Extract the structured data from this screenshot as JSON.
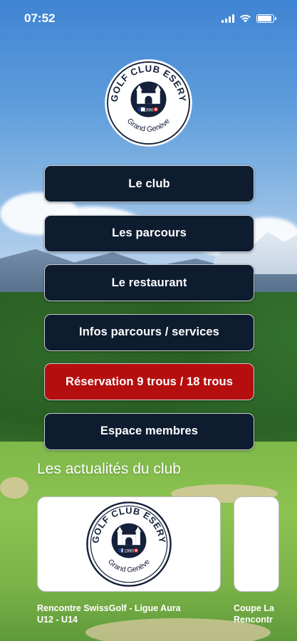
{
  "status_bar": {
    "time": "07:52"
  },
  "logo": {
    "text_top": "GOLF CLUB ESERY",
    "text_bottom": "Grand Genève",
    "year": "1990"
  },
  "menu": {
    "items": [
      {
        "label": "Le club"
      },
      {
        "label": "Les parcours"
      },
      {
        "label": "Le restaurant"
      },
      {
        "label": "Infos parcours / services"
      },
      {
        "label": "Réservation 9 trous / 18 trous"
      },
      {
        "label": "Espace membres"
      }
    ]
  },
  "news": {
    "title": "Les actualités du club",
    "cards": [
      {
        "caption_line1": "Rencontre SwissGolf - Ligue Aura",
        "caption_line2": "U12 - U14"
      },
      {
        "caption_line1": "Coupe La",
        "caption_line2": "Rencontr"
      }
    ]
  },
  "colors": {
    "button_bg": "#0e1c2f",
    "accent_red": "#b50e0e",
    "logo_navy": "#15203a",
    "flag_red": "#d52b1e",
    "flag_blue": "#1e3a8a"
  },
  "icons": [
    "cellular-signal-icon",
    "wifi-icon",
    "battery-icon",
    "golf-club-logo"
  ]
}
